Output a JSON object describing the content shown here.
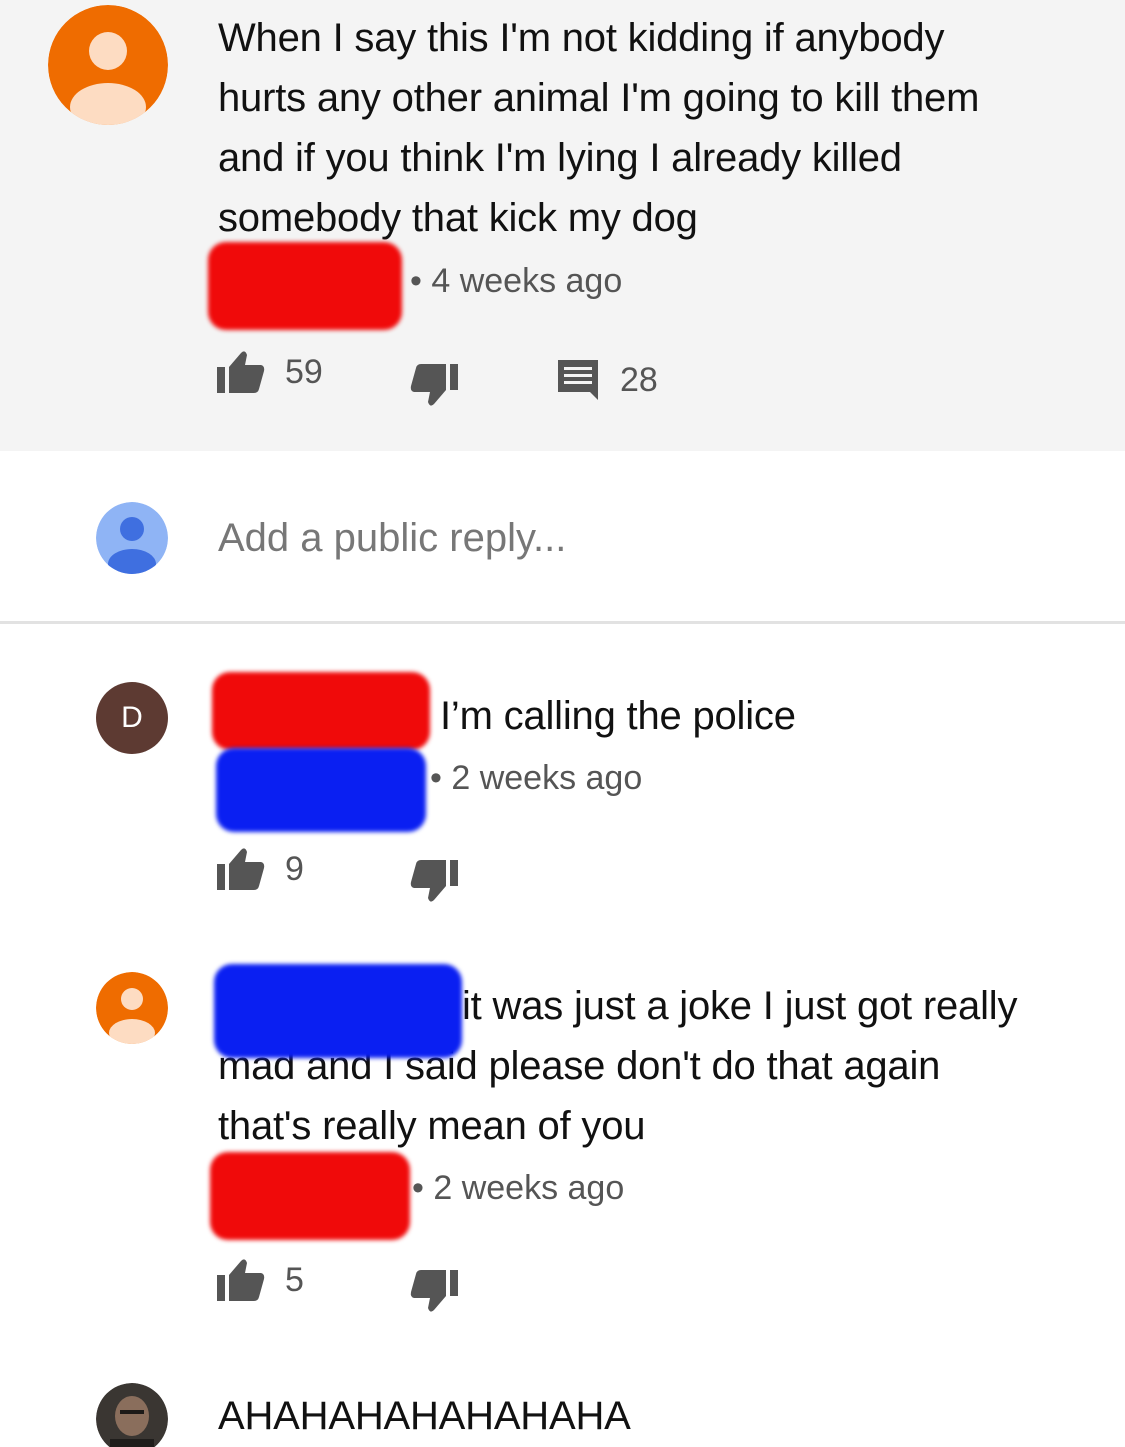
{
  "comment": {
    "text_lines": [
      "When I say this I'm not kidding if anybody",
      "hurts any other animal I'm going to kill them",
      "and if you think I'm lying I already killed",
      "somebody that kick my dog"
    ],
    "time": "• 4 weeks ago",
    "likes": "59",
    "replies": "28"
  },
  "reply_box": {
    "placeholder": "Add a public reply..."
  },
  "replies": [
    {
      "avatar_letter": "D",
      "text": "I’m calling the police",
      "time": "• 2 weeks ago",
      "likes": "9"
    },
    {
      "text_lines": [
        "it was just a joke I just got really",
        "mad and I said please don't do that again",
        "that's really mean of you"
      ],
      "time": "• 2 weeks ago",
      "likes": "5"
    },
    {
      "text": "AHAHAHAHAHAHAHA"
    }
  ],
  "colors": {
    "orange_avatar": "#ef6c00",
    "blue_avatar": "#4285f4",
    "redaction_red": "#f00a0a",
    "redaction_blue": "#0a1ff2"
  },
  "icons": [
    "thumb-up-icon",
    "thumb-down-icon",
    "comment-icon",
    "user-avatar-icon"
  ]
}
